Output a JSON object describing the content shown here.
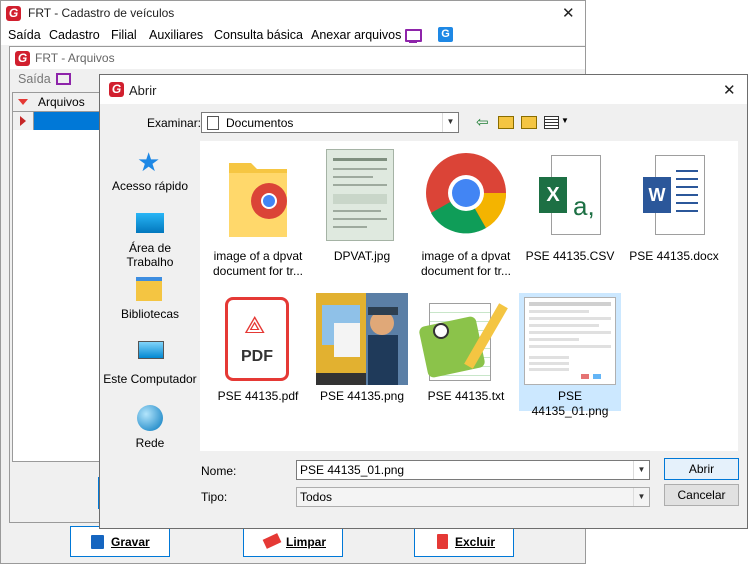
{
  "main_window": {
    "title": "FRT - Cadastro de veículos",
    "menu": [
      "Saída",
      "Cadastro",
      "Filial",
      "Auxiliares",
      "Consulta básica",
      "Anexar arquivos"
    ],
    "buttons": {
      "save": "Gravar",
      "clear": "Limpar",
      "delete": "Excluir"
    }
  },
  "arquivos_window": {
    "title": "FRT - Arquivos",
    "menu_saida": "Saída",
    "grid_header": "Arquivos"
  },
  "dialog": {
    "title": "Abrir",
    "look_in_label": "Examinar:",
    "look_in_value": "Documentos",
    "places": [
      "Acesso rápido",
      "Área de Trabalho",
      "Bibliotecas",
      "Este Computador",
      "Rede"
    ],
    "files": [
      {
        "name": "image of a dpvat document for tr...",
        "line1": "image of a dpvat",
        "line2": "document for tr...",
        "icon": "folder-chrome-icon"
      },
      {
        "name": "DPVAT.jpg",
        "icon": "document-thumbnail-icon"
      },
      {
        "name": "image of a dpvat document for tr...",
        "line1": "image of a dpvat",
        "line2": "document for tr...",
        "icon": "chrome-icon"
      },
      {
        "name": "PSE 44135.CSV",
        "icon": "excel-csv-icon"
      },
      {
        "name": "PSE 44135.docx",
        "icon": "word-icon"
      },
      {
        "name": "PSE 44135.pdf",
        "icon": "pdf-icon"
      },
      {
        "name": "PSE 44135.png",
        "icon": "image-thumbnail-icon"
      },
      {
        "name": "PSE 44135.txt",
        "icon": "notepad-plus-icon"
      },
      {
        "name": "PSE 44135_01.png",
        "icon": "screenshot-thumbnail-icon",
        "selected": true
      }
    ],
    "name_label": "Nome:",
    "name_value": "PSE 44135_01.png",
    "type_label": "Tipo:",
    "type_value": "Todos",
    "open_button": "Abrir",
    "cancel_button": "Cancelar",
    "pdf_badge": "PDF",
    "excel_letter": "X",
    "excel_suffix": "a,",
    "word_letter": "W"
  },
  "colors": {
    "accent": "#0078d7",
    "selection": "#cce8ff",
    "brand_red": "#d11f2e",
    "grid_selected_row": "#0078d7"
  }
}
